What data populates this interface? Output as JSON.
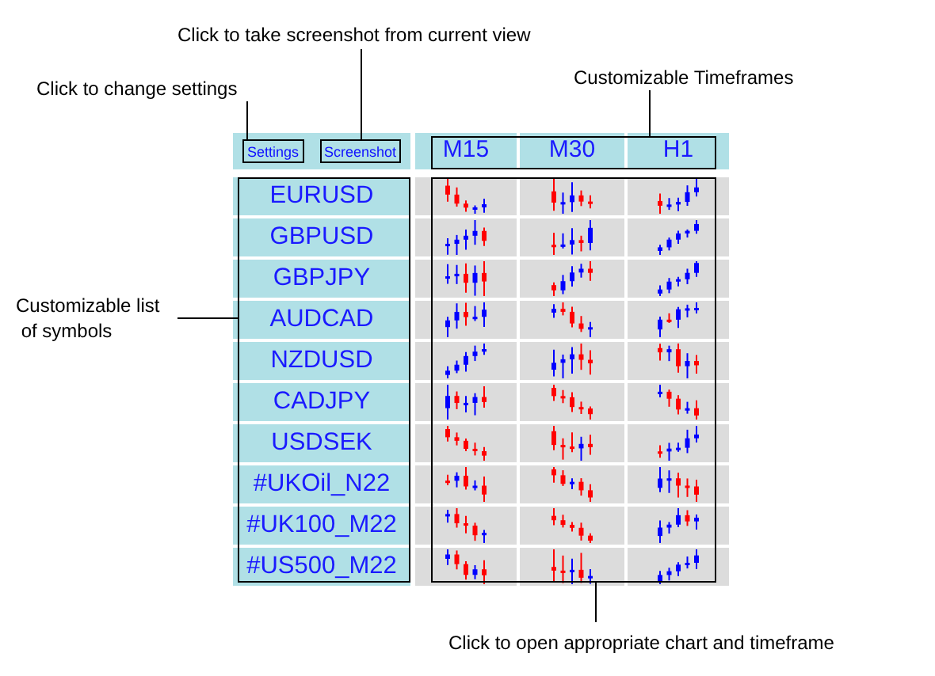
{
  "annotations": [
    {
      "kind": "screenshot",
      "text": "Click to take screenshot from current view"
    },
    {
      "kind": "settings",
      "text": "Click to change settings"
    },
    {
      "kind": "timeframes",
      "text": "Customizable Timeframes"
    },
    {
      "kind": "symbols",
      "lines": [
        "Customizable list",
        " of symbols"
      ]
    },
    {
      "kind": "charts",
      "text": "Click to open appropriate chart and timeframe"
    }
  ],
  "toolbar": {
    "buttons": [
      "Settings",
      "Screenshot"
    ]
  },
  "timeframes": [
    "M15",
    "M30",
    "H1"
  ],
  "symbols": [
    "EURUSD",
    "GBPUSD",
    "GBPJPY",
    "AUDCAD",
    "NZDUSD",
    "CADJPY",
    "USDSEK",
    "#UKOil_N22",
    "#UK100_M22",
    "#US500_M22"
  ]
}
